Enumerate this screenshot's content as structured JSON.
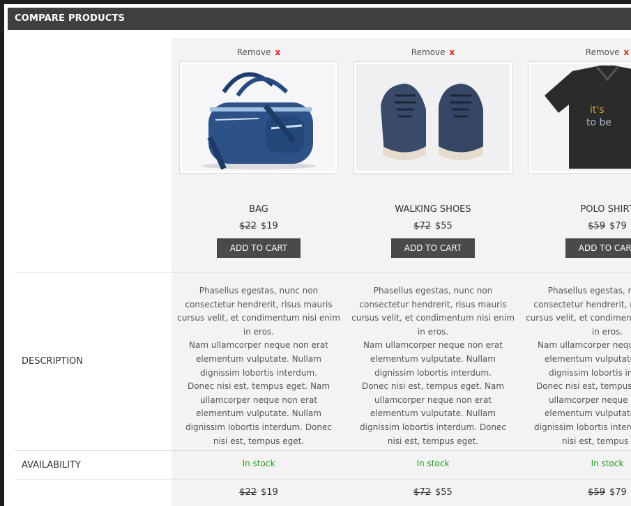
{
  "header": {
    "title": "COMPARE PRODUCTS"
  },
  "rows": {
    "description_label": "DESCRIPTION",
    "availability_label": "AVAILABILITY"
  },
  "remove": {
    "label": "Remove",
    "icon": "x"
  },
  "products": [
    {
      "name": "BAG",
      "old_price": "$22",
      "price": "$19",
      "add_to_cart": "ADD TO CART",
      "description": "Phasellus egestas, nunc non consectetur hendrerit, risus mauris cursus velit, et condimentum nisi enim in eros.\nNam ullamcorper neque non erat elementum vulputate. Nullam dignissim lobortis interdum.\nDonec nisi est, tempus eget. Nam ullamcorper neque non erat elementum vulputate. Nullam dignissim lobortis interdum. Donec nisi est, tempus eget.",
      "availability": "In stock",
      "image": "bag-image"
    },
    {
      "name": "WALKING SHOES",
      "old_price": "$72",
      "price": "$55",
      "add_to_cart": "ADD TO CART",
      "description": "Phasellus egestas, nunc non consectetur hendrerit, risus mauris cursus velit, et condimentum nisi enim in eros.\nNam ullamcorper neque non erat elementum vulputate. Nullam dignissim lobortis interdum.\nDonec nisi est, tempus eget. Nam ullamcorper neque non erat elementum vulputate. Nullam dignissim lobortis interdum. Donec nisi est, tempus eget.",
      "availability": "In stock",
      "image": "shoes-image"
    },
    {
      "name": "POLO SHIRT",
      "old_price": "$59",
      "price": "$79",
      "add_to_cart": "ADD TO CART",
      "description": "Phasellus egestas, nunc non consectetur hendrerit, risus mauris cursus velit, et condimentum nisi enim in eros.\nNam ullamcorper neque non erat elementum vulputate. Nullam dignissim lobortis interdum.\nDonec nisi est, tempus eget. Nam ullamcorper neque non erat elementum vulputate. Nullam dignissim lobortis interdum. Donec nisi est, tempus eget.",
      "availability": "In stock",
      "image": "shirt-image"
    }
  ],
  "colors": {
    "header_bg": "#3f3f3f",
    "button_bg": "#4a4a4a",
    "remove_x": "#e0241b",
    "in_stock": "#1f9b1f",
    "shaded_col": "#f3f3f3"
  }
}
